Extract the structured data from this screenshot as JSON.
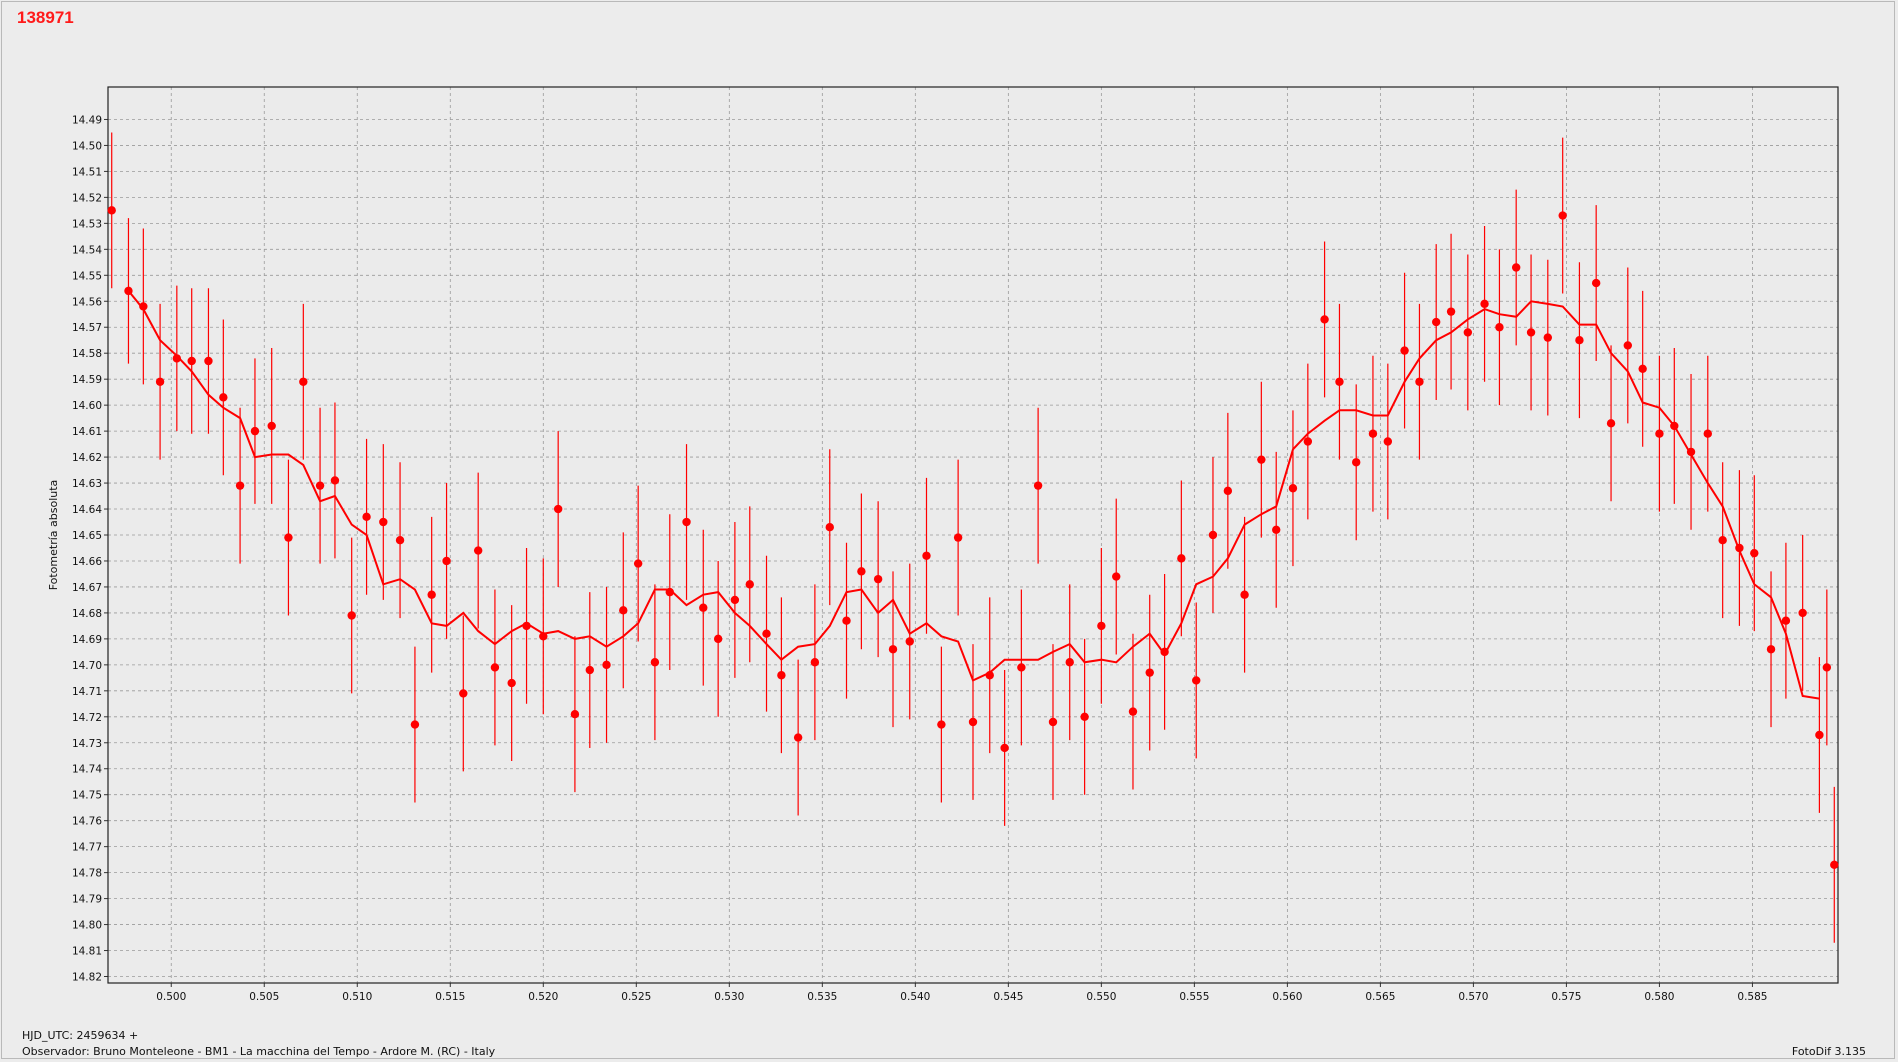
{
  "header": {
    "title": "138971"
  },
  "footer": {
    "hjd_label": "HJD_UTC: 2459634 +",
    "observer": "Observador: Bruno Monteleone - BM1 - La macchina del Tempo - Ardore M. (RC) - Italy",
    "software": "FotoDif 3.135"
  },
  "colors": {
    "series": "#ff0000",
    "background": "#ececec",
    "plot_background": "#ebebeb",
    "grid": "#9a9a9a"
  },
  "chart_data": {
    "type": "scatter",
    "title": "138971",
    "xlabel": "HJD_UTC: 2459634 +",
    "ylabel": "Fotometría absoluta",
    "xlim": [
      0.4966,
      0.5896
    ],
    "ylim": [
      14.4775,
      14.8225
    ],
    "y_inverted": true,
    "grid": true,
    "x_ticks": [
      "0.500",
      "0.505",
      "0.510",
      "0.515",
      "0.520",
      "0.525",
      "0.530",
      "0.535",
      "0.540",
      "0.545",
      "0.550",
      "0.555",
      "0.560",
      "0.565",
      "0.570",
      "0.575",
      "0.580",
      "0.585"
    ],
    "y_ticks": [
      "14.49",
      "14.50",
      "14.51",
      "14.52",
      "14.53",
      "14.54",
      "14.55",
      "14.56",
      "14.57",
      "14.58",
      "14.59",
      "14.60",
      "14.61",
      "14.62",
      "14.63",
      "14.64",
      "14.65",
      "14.66",
      "14.67",
      "14.68",
      "14.69",
      "14.70",
      "14.71",
      "14.72",
      "14.73",
      "14.74",
      "14.75",
      "14.76",
      "14.77",
      "14.78",
      "14.79",
      "14.80",
      "14.81",
      "14.82"
    ],
    "series": [
      {
        "points": [
          [
            0.4968,
            14.525,
            0.03
          ],
          [
            0.4977,
            14.556,
            0.028
          ],
          [
            0.4985,
            14.562,
            0.03
          ],
          [
            0.4994,
            14.591,
            0.03
          ],
          [
            0.5003,
            14.582,
            0.028
          ],
          [
            0.5011,
            14.583,
            0.028
          ],
          [
            0.502,
            14.583,
            0.028
          ],
          [
            0.5028,
            14.597,
            0.03
          ],
          [
            0.5037,
            14.631,
            0.03
          ],
          [
            0.5045,
            14.61,
            0.028
          ],
          [
            0.5054,
            14.608,
            0.03
          ],
          [
            0.5063,
            14.651,
            0.03
          ],
          [
            0.5071,
            14.591,
            0.03
          ],
          [
            0.508,
            14.631,
            0.03
          ],
          [
            0.5088,
            14.629,
            0.03
          ],
          [
            0.5097,
            14.681,
            0.03
          ],
          [
            0.5105,
            14.643,
            0.03
          ],
          [
            0.5114,
            14.645,
            0.03
          ],
          [
            0.5123,
            14.652,
            0.03
          ],
          [
            0.5131,
            14.723,
            0.03
          ],
          [
            0.514,
            14.673,
            0.03
          ],
          [
            0.5148,
            14.66,
            0.03
          ],
          [
            0.5157,
            14.711,
            0.03
          ],
          [
            0.5165,
            14.656,
            0.03
          ],
          [
            0.5174,
            14.701,
            0.03
          ],
          [
            0.5183,
            14.707,
            0.03
          ],
          [
            0.5191,
            14.685,
            0.03
          ],
          [
            0.52,
            14.689,
            0.03
          ],
          [
            0.5208,
            14.64,
            0.03
          ],
          [
            0.5217,
            14.719,
            0.03
          ],
          [
            0.5225,
            14.702,
            0.03
          ],
          [
            0.5234,
            14.7,
            0.03
          ],
          [
            0.5243,
            14.679,
            0.03
          ],
          [
            0.5251,
            14.661,
            0.03
          ],
          [
            0.526,
            14.699,
            0.03
          ],
          [
            0.5268,
            14.672,
            0.03
          ],
          [
            0.5277,
            14.645,
            0.03
          ],
          [
            0.5286,
            14.678,
            0.03
          ],
          [
            0.5294,
            14.69,
            0.03
          ],
          [
            0.5303,
            14.675,
            0.03
          ],
          [
            0.5311,
            14.669,
            0.03
          ],
          [
            0.532,
            14.688,
            0.03
          ],
          [
            0.5328,
            14.704,
            0.03
          ],
          [
            0.5337,
            14.728,
            0.03
          ],
          [
            0.5346,
            14.699,
            0.03
          ],
          [
            0.5354,
            14.647,
            0.03
          ],
          [
            0.5363,
            14.683,
            0.03
          ],
          [
            0.5371,
            14.664,
            0.03
          ],
          [
            0.538,
            14.667,
            0.03
          ],
          [
            0.5388,
            14.694,
            0.03
          ],
          [
            0.5397,
            14.691,
            0.03
          ],
          [
            0.5406,
            14.658,
            0.03
          ],
          [
            0.5414,
            14.723,
            0.03
          ],
          [
            0.5423,
            14.651,
            0.03
          ],
          [
            0.5431,
            14.722,
            0.03
          ],
          [
            0.544,
            14.704,
            0.03
          ],
          [
            0.5448,
            14.732,
            0.03
          ],
          [
            0.5457,
            14.701,
            0.03
          ],
          [
            0.5466,
            14.631,
            0.03
          ],
          [
            0.5474,
            14.722,
            0.03
          ],
          [
            0.5483,
            14.699,
            0.03
          ],
          [
            0.5491,
            14.72,
            0.03
          ],
          [
            0.55,
            14.685,
            0.03
          ],
          [
            0.5508,
            14.666,
            0.03
          ],
          [
            0.5517,
            14.718,
            0.03
          ],
          [
            0.5526,
            14.703,
            0.03
          ],
          [
            0.5534,
            14.695,
            0.03
          ],
          [
            0.5543,
            14.659,
            0.03
          ],
          [
            0.5551,
            14.706,
            0.03
          ],
          [
            0.556,
            14.65,
            0.03
          ],
          [
            0.5568,
            14.633,
            0.03
          ],
          [
            0.5577,
            14.673,
            0.03
          ],
          [
            0.5586,
            14.621,
            0.03
          ],
          [
            0.5594,
            14.648,
            0.03
          ],
          [
            0.5603,
            14.632,
            0.03
          ],
          [
            0.5611,
            14.614,
            0.03
          ],
          [
            0.562,
            14.567,
            0.03
          ],
          [
            0.5628,
            14.591,
            0.03
          ],
          [
            0.5637,
            14.622,
            0.03
          ],
          [
            0.5646,
            14.611,
            0.03
          ],
          [
            0.5654,
            14.614,
            0.03
          ],
          [
            0.5663,
            14.579,
            0.03
          ],
          [
            0.5671,
            14.591,
            0.03
          ],
          [
            0.568,
            14.568,
            0.03
          ],
          [
            0.5688,
            14.564,
            0.03
          ],
          [
            0.5697,
            14.572,
            0.03
          ],
          [
            0.5706,
            14.561,
            0.03
          ],
          [
            0.5714,
            14.57,
            0.03
          ],
          [
            0.5723,
            14.547,
            0.03
          ],
          [
            0.5731,
            14.572,
            0.03
          ],
          [
            0.574,
            14.574,
            0.03
          ],
          [
            0.5748,
            14.527,
            0.03
          ],
          [
            0.5757,
            14.575,
            0.03
          ],
          [
            0.5766,
            14.553,
            0.03
          ],
          [
            0.5774,
            14.607,
            0.03
          ],
          [
            0.5783,
            14.577,
            0.03
          ],
          [
            0.5791,
            14.586,
            0.03
          ],
          [
            0.58,
            14.611,
            0.03
          ],
          [
            0.5808,
            14.608,
            0.03
          ],
          [
            0.5817,
            14.618,
            0.03
          ],
          [
            0.5826,
            14.611,
            0.03
          ],
          [
            0.5834,
            14.652,
            0.03
          ],
          [
            0.5843,
            14.655,
            0.03
          ],
          [
            0.5851,
            14.657,
            0.03
          ],
          [
            0.586,
            14.694,
            0.03
          ],
          [
            0.5868,
            14.683,
            0.03
          ],
          [
            0.5877,
            14.68,
            0.03
          ],
          [
            0.5886,
            14.727,
            0.03
          ],
          [
            0.5894,
            14.777,
            0.03
          ],
          [
            0.589,
            14.701,
            0.03
          ]
        ],
        "smooth": [
          [
            0.4977,
            14.556
          ],
          [
            0.4985,
            14.563
          ],
          [
            0.4994,
            14.575
          ],
          [
            0.5003,
            14.581
          ],
          [
            0.5011,
            14.587
          ],
          [
            0.502,
            14.596
          ],
          [
            0.5028,
            14.601
          ],
          [
            0.5037,
            14.605
          ],
          [
            0.5045,
            14.62
          ],
          [
            0.5054,
            14.619
          ],
          [
            0.5063,
            14.619
          ],
          [
            0.5071,
            14.623
          ],
          [
            0.508,
            14.637
          ],
          [
            0.5088,
            14.635
          ],
          [
            0.5097,
            14.646
          ],
          [
            0.5105,
            14.65
          ],
          [
            0.5114,
            14.669
          ],
          [
            0.5123,
            14.667
          ],
          [
            0.5131,
            14.671
          ],
          [
            0.514,
            14.684
          ],
          [
            0.5148,
            14.685
          ],
          [
            0.5157,
            14.68
          ],
          [
            0.5165,
            14.687
          ],
          [
            0.5174,
            14.692
          ],
          [
            0.5183,
            14.687
          ],
          [
            0.5191,
            14.684
          ],
          [
            0.52,
            14.688
          ],
          [
            0.5208,
            14.687
          ],
          [
            0.5217,
            14.69
          ],
          [
            0.5225,
            14.689
          ],
          [
            0.5234,
            14.693
          ],
          [
            0.5243,
            14.689
          ],
          [
            0.5251,
            14.684
          ],
          [
            0.526,
            14.671
          ],
          [
            0.5268,
            14.671
          ],
          [
            0.5277,
            14.677
          ],
          [
            0.5286,
            14.673
          ],
          [
            0.5294,
            14.672
          ],
          [
            0.5303,
            14.68
          ],
          [
            0.5311,
            14.685
          ],
          [
            0.532,
            14.692
          ],
          [
            0.5328,
            14.698
          ],
          [
            0.5337,
            14.693
          ],
          [
            0.5346,
            14.692
          ],
          [
            0.5354,
            14.685
          ],
          [
            0.5363,
            14.672
          ],
          [
            0.5371,
            14.671
          ],
          [
            0.538,
            14.68
          ],
          [
            0.5388,
            14.675
          ],
          [
            0.5397,
            14.688
          ],
          [
            0.5406,
            14.684
          ],
          [
            0.5414,
            14.689
          ],
          [
            0.5423,
            14.691
          ],
          [
            0.5431,
            14.706
          ],
          [
            0.544,
            14.703
          ],
          [
            0.5448,
            14.698
          ],
          [
            0.5457,
            14.698
          ],
          [
            0.5466,
            14.698
          ],
          [
            0.5474,
            14.695
          ],
          [
            0.5483,
            14.692
          ],
          [
            0.5491,
            14.699
          ],
          [
            0.55,
            14.698
          ],
          [
            0.5508,
            14.699
          ],
          [
            0.5517,
            14.693
          ],
          [
            0.5526,
            14.688
          ],
          [
            0.5534,
            14.696
          ],
          [
            0.5543,
            14.684
          ],
          [
            0.5551,
            14.669
          ],
          [
            0.556,
            14.666
          ],
          [
            0.5568,
            14.659
          ],
          [
            0.5577,
            14.646
          ],
          [
            0.5586,
            14.642
          ],
          [
            0.5594,
            14.639
          ],
          [
            0.5603,
            14.617
          ],
          [
            0.5611,
            14.611
          ],
          [
            0.562,
            14.606
          ],
          [
            0.5628,
            14.602
          ],
          [
            0.5637,
            14.602
          ],
          [
            0.5646,
            14.604
          ],
          [
            0.5654,
            14.604
          ],
          [
            0.5663,
            14.591
          ],
          [
            0.5671,
            14.582
          ],
          [
            0.568,
            14.575
          ],
          [
            0.5688,
            14.572
          ],
          [
            0.5697,
            14.567
          ],
          [
            0.5706,
            14.563
          ],
          [
            0.5714,
            14.565
          ],
          [
            0.5723,
            14.566
          ],
          [
            0.5731,
            14.56
          ],
          [
            0.574,
            14.561
          ],
          [
            0.5748,
            14.562
          ],
          [
            0.5757,
            14.569
          ],
          [
            0.5766,
            14.569
          ],
          [
            0.5774,
            14.58
          ],
          [
            0.5783,
            14.587
          ],
          [
            0.5791,
            14.599
          ],
          [
            0.58,
            14.601
          ],
          [
            0.5808,
            14.608
          ],
          [
            0.5817,
            14.619
          ],
          [
            0.5826,
            14.63
          ],
          [
            0.5834,
            14.639
          ],
          [
            0.5843,
            14.656
          ],
          [
            0.5851,
            14.669
          ],
          [
            0.586,
            14.674
          ],
          [
            0.5868,
            14.688
          ],
          [
            0.5877,
            14.712
          ],
          [
            0.5886,
            14.713
          ]
        ]
      }
    ]
  }
}
